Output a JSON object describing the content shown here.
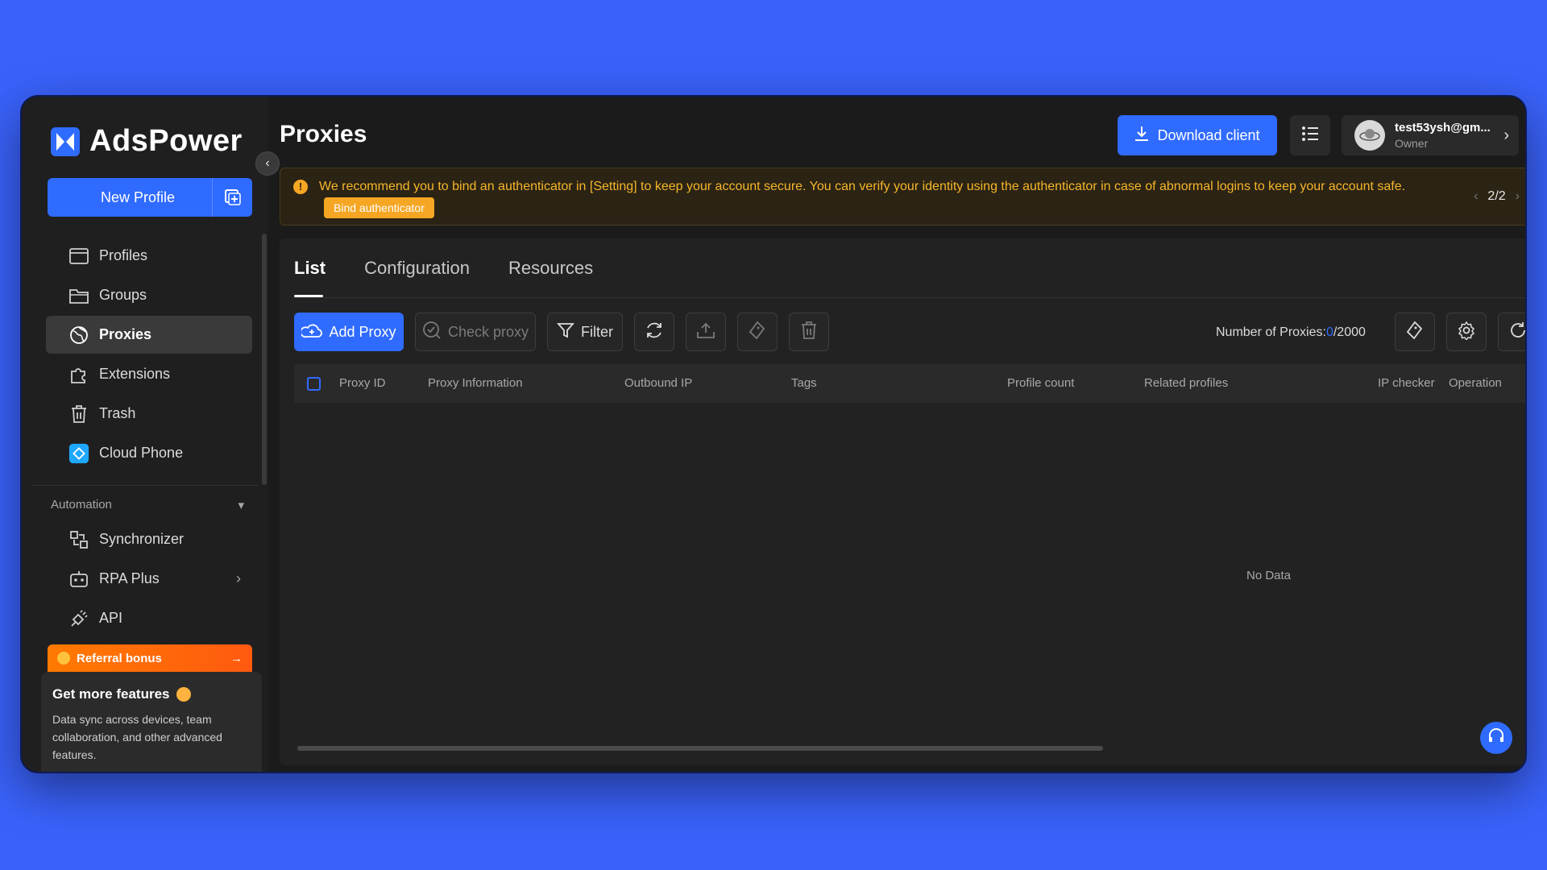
{
  "app": {
    "name": "AdsPower",
    "brand_color": "#2f6bff"
  },
  "sidebar": {
    "new_profile_label": "New Profile",
    "items": [
      {
        "label": "Profiles",
        "icon": "browser-window-icon"
      },
      {
        "label": "Groups",
        "icon": "folder-icon"
      },
      {
        "label": "Proxies",
        "icon": "proxy-globe-icon",
        "active": true
      },
      {
        "label": "Extensions",
        "icon": "puzzle-icon"
      },
      {
        "label": "Trash",
        "icon": "trash-icon"
      },
      {
        "label": "Cloud Phone",
        "icon": "cloud-phone-icon"
      }
    ],
    "automation": {
      "label": "Automation",
      "items": [
        {
          "label": "Synchronizer",
          "icon": "sync-icon"
        },
        {
          "label": "RPA Plus",
          "icon": "robot-icon"
        },
        {
          "label": "API",
          "icon": "plug-icon"
        }
      ]
    },
    "referral_label": "Referral bonus",
    "features_title": "Get more features",
    "features_desc": "Data sync across devices, team collaboration, and other advanced features."
  },
  "header": {
    "title": "Proxies",
    "download_label": "Download client",
    "account_email": "test53ysh@gm...",
    "account_role": "Owner"
  },
  "banner": {
    "text": "We recommend you to bind an authenticator in [Setting] to keep your account secure. You can verify your identity using the authenticator in case of abnormal logins to keep your account safe.",
    "button_label": "Bind authenticator",
    "pager": "2/2"
  },
  "tabs": [
    "List",
    "Configuration",
    "Resources"
  ],
  "toolbar": {
    "add_proxy": "Add Proxy",
    "check_proxy": "Check proxy",
    "filter": "Filter",
    "count_label": "Number of Proxies:",
    "count_current": "0",
    "count_max": "/2000"
  },
  "table": {
    "columns": [
      "Proxy ID",
      "Proxy Information",
      "Outbound IP",
      "Tags",
      "Profile count",
      "Related profiles",
      "IP checker",
      "Operation"
    ],
    "empty_text": "No Data"
  }
}
